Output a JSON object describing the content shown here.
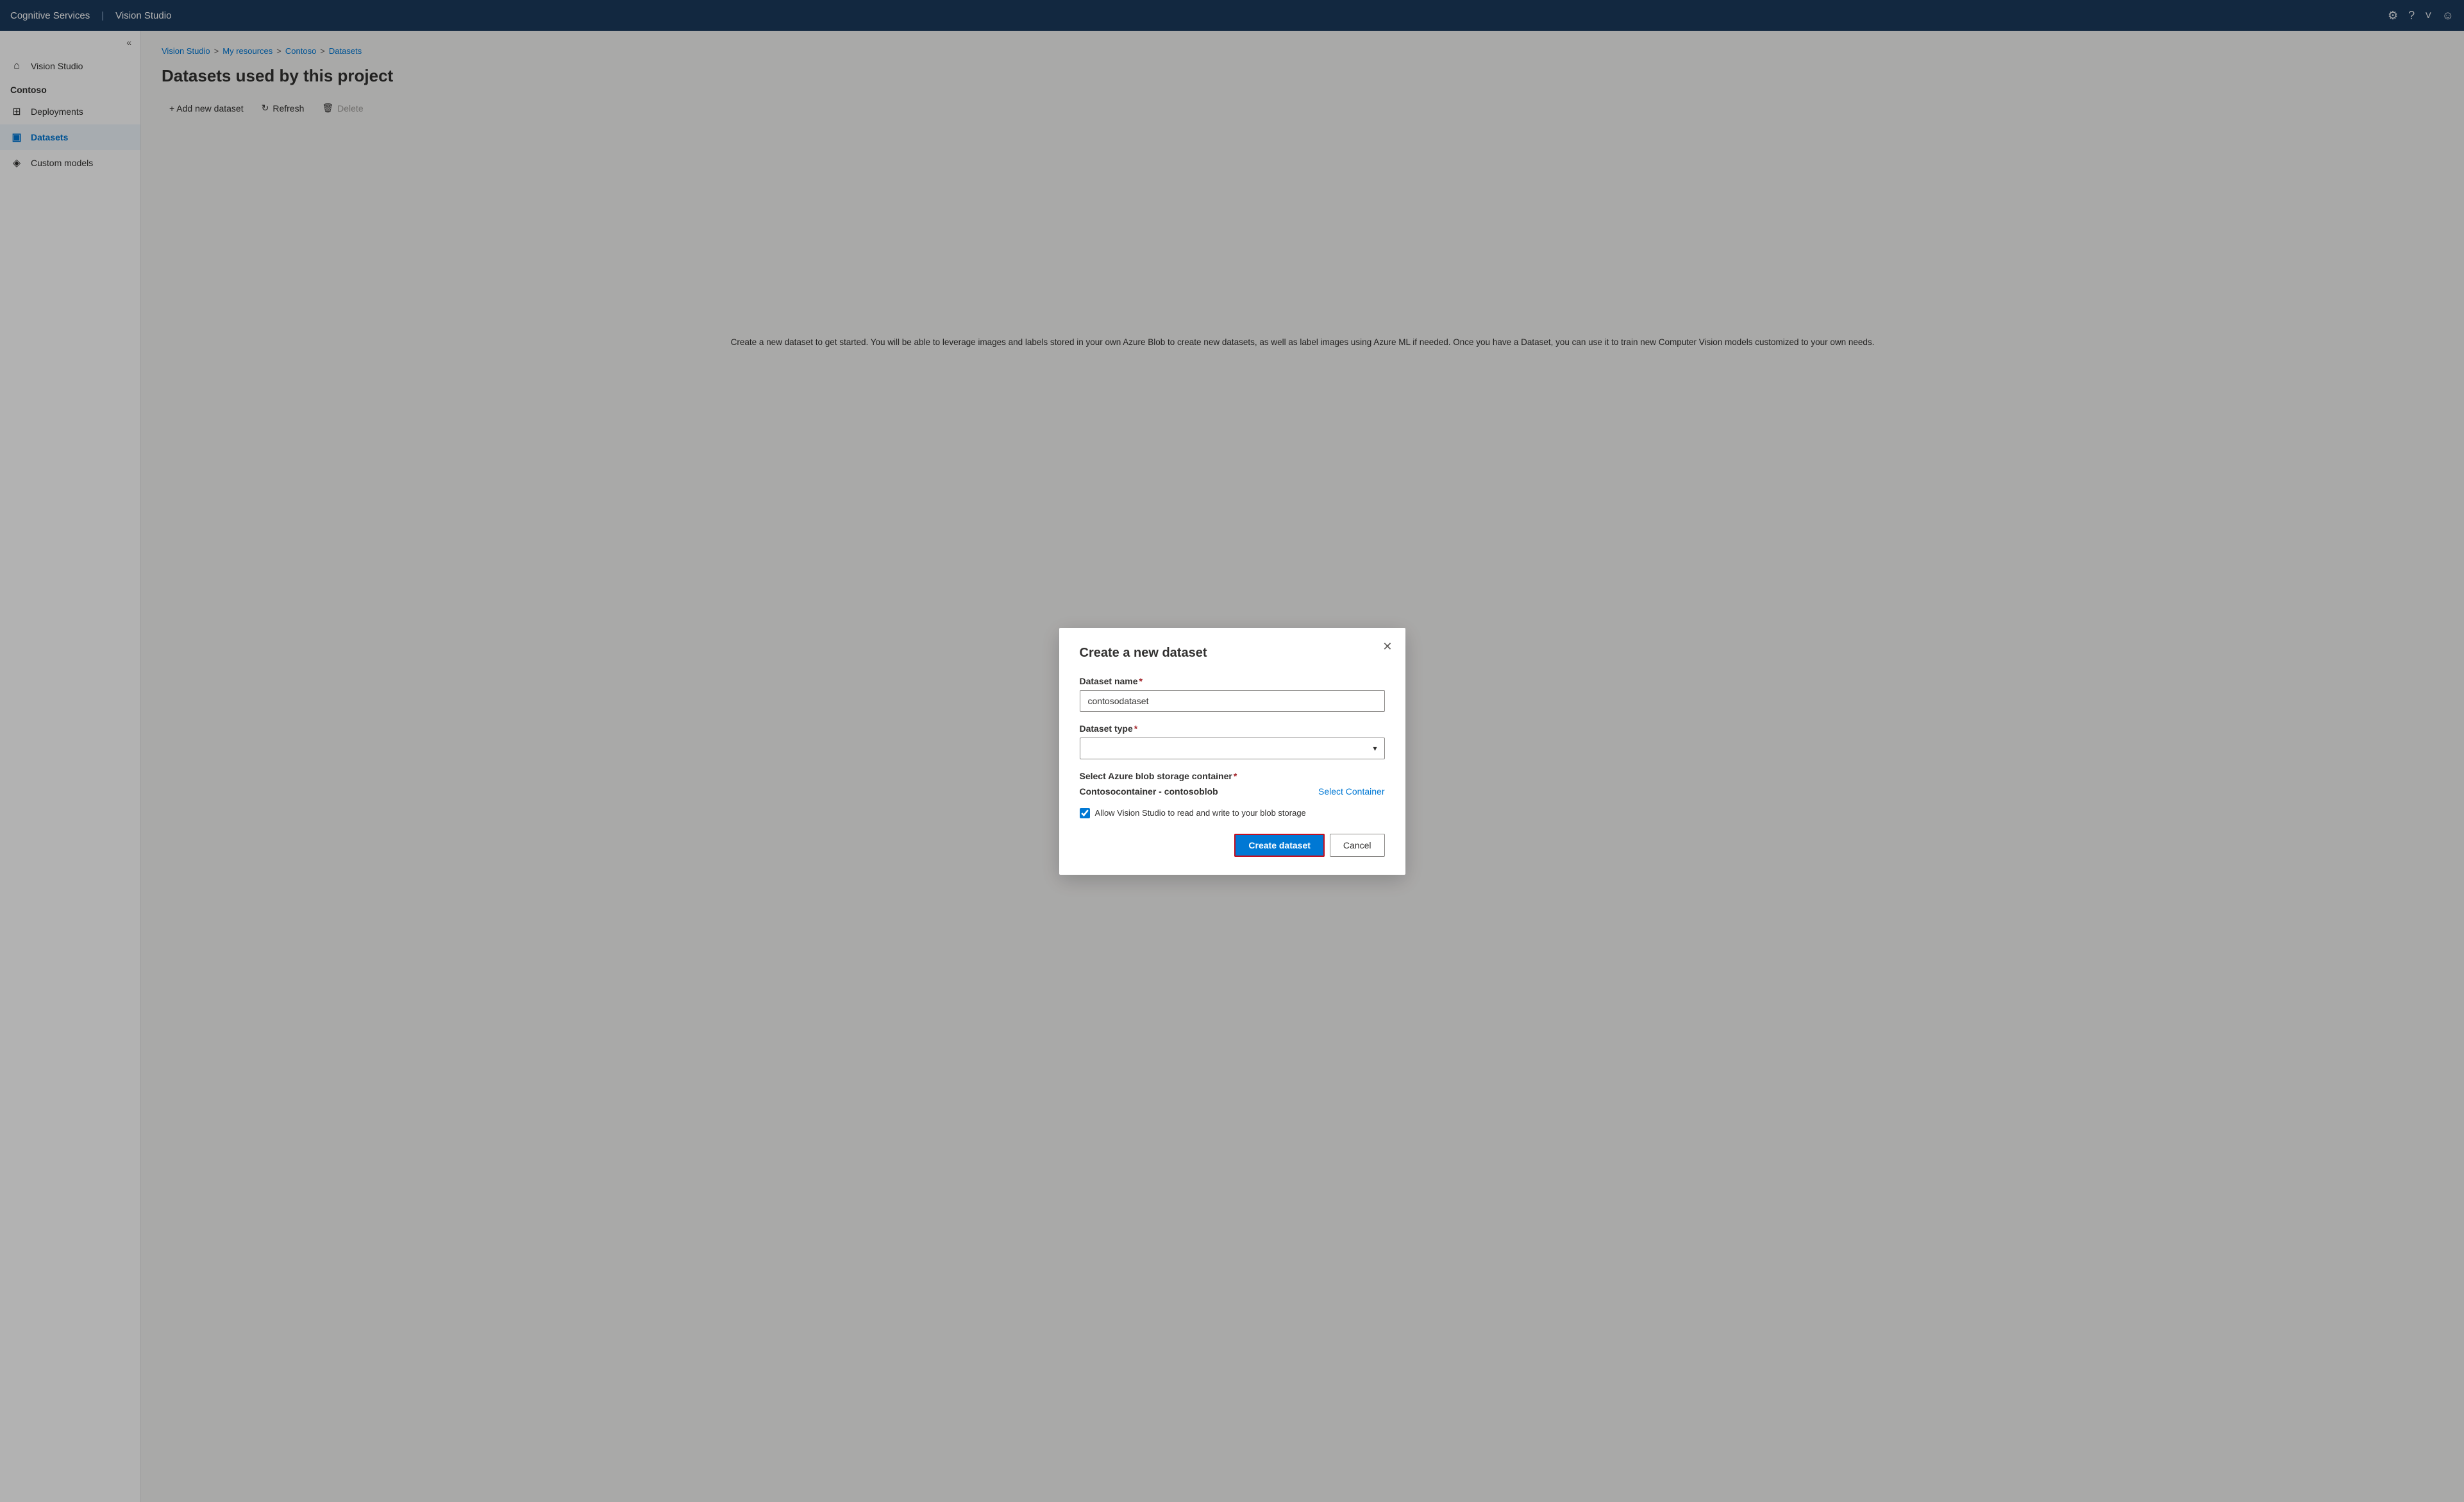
{
  "topbar": {
    "brand": "Cognitive Services",
    "separator": "|",
    "app_name": "Vision Studio",
    "icons": {
      "settings": "⚙",
      "help": "?",
      "chevron": "˅",
      "user": "☺"
    }
  },
  "sidebar": {
    "collapse_icon": "«",
    "section_title": "Contoso",
    "items": [
      {
        "id": "vision-studio",
        "label": "Vision Studio",
        "icon": "⌂",
        "active": false
      },
      {
        "id": "deployments",
        "label": "Deployments",
        "icon": "⊞",
        "active": false
      },
      {
        "id": "datasets",
        "label": "Datasets",
        "icon": "▣",
        "active": true
      },
      {
        "id": "custom-models",
        "label": "Custom models",
        "icon": "◈",
        "active": false
      }
    ]
  },
  "breadcrumb": {
    "items": [
      {
        "label": "Vision Studio",
        "link": true
      },
      {
        "label": "My resources",
        "link": true
      },
      {
        "label": "Contoso",
        "link": true
      },
      {
        "label": "Datasets",
        "link": true
      }
    ],
    "separator": ">"
  },
  "page": {
    "title": "Datasets used by this project"
  },
  "toolbar": {
    "add_label": "+ Add new dataset",
    "refresh_label": "Refresh",
    "refresh_icon": "↻",
    "delete_label": "Delete",
    "delete_icon": "🗑"
  },
  "dialog": {
    "title": "Create a new dataset",
    "close_icon": "✕",
    "dataset_name_label": "Dataset name",
    "dataset_name_required": true,
    "dataset_name_value": "contosodataset",
    "dataset_type_label": "Dataset type",
    "dataset_type_required": true,
    "dataset_type_placeholder": "",
    "storage_label": "Select Azure blob storage container",
    "storage_required": true,
    "storage_container_name": "Contosocontainer - contosoblob",
    "storage_select_link": "Select Container",
    "checkbox_label": "Allow Vision Studio to read and write to your blob storage",
    "checkbox_checked": true,
    "create_button": "Create dataset",
    "cancel_button": "Cancel"
  },
  "description": {
    "text": "Create a new dataset to get started. You will be able to leverage images and labels stored in your own Azure Blob to create new datasets, as well as label images using Azure ML if needed. Once you have a Dataset, you can use it to train new Computer Vision models customized to your own needs."
  }
}
